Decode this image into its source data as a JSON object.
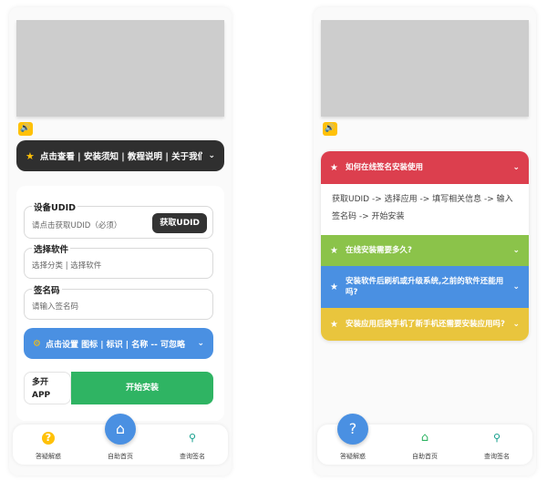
{
  "left": {
    "notice_bar": "点击查看 | 安装须知 | 教程说明 | 关于我们",
    "udid": {
      "label": "设备UDID",
      "placeholder": "请点击获取UDID（必须）",
      "button": "获取UDID"
    },
    "app": {
      "label": "选择软件",
      "value": "选择分类 | 选择软件"
    },
    "sign": {
      "label": "签名码",
      "placeholder": "请输入签名码"
    },
    "settings_bar": "点击设置 图标 | 标识 | 名称 -- 可忽略",
    "multi_label_1": "多开",
    "multi_label_2": "APP",
    "install_button": "开始安装",
    "nav": [
      "答疑解惑",
      "自助首页",
      "查询签名"
    ]
  },
  "right": {
    "accordion": [
      {
        "title": "如何在线签名安装使用",
        "color": "#dc3f4e"
      },
      {
        "title": "在线安装需要多久?",
        "color": "#8bc34a"
      },
      {
        "title": "安装软件后刷机或升级系统,之前的软件还能用吗?",
        "color": "#4a90e2"
      },
      {
        "title": "安装应用后换手机了新手机还需要安装应用吗?",
        "color": "#e9c53d"
      }
    ],
    "answer": "获取UDID -> 选择应用 -> 填写相关信息 -> 输入签名码 -> 开始安装",
    "nav": [
      "答疑解惑",
      "自助首页",
      "查询签名"
    ]
  },
  "colors": {
    "accent_blue": "#4a90e2",
    "green": "#2fb463",
    "yellow": "#ffc107",
    "dark": "#2f2f2f"
  },
  "icons": {
    "speaker": "speaker-icon",
    "star": "star-icon",
    "gear": "gear-icon",
    "help": "question-icon",
    "home": "home-icon",
    "search": "search-icon"
  }
}
